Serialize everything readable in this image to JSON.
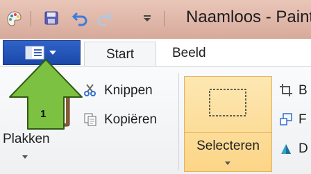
{
  "window": {
    "title": "Naamloos - Paint"
  },
  "quick_access": {
    "icons": [
      "paint-app-icon",
      "save-icon",
      "undo-icon",
      "redo-icon",
      "customize-qat-icon"
    ]
  },
  "tabs": {
    "file_menu_icon": "file-menu-icon",
    "start": "Start",
    "beeld": "Beeld"
  },
  "clipboard": {
    "paste_label": "Plakken",
    "cut_label": "Knippen",
    "copy_label": "Kopiëren"
  },
  "image": {
    "select_label": "Selecteren",
    "crop_initial": "B",
    "resize_initial": "F",
    "rotate_initial": "D"
  },
  "annotation": {
    "step_number": "1",
    "arrow_color": "#7dc142",
    "arrow_outline": "#2e5b12"
  },
  "colors": {
    "file_button": "#1a48a8",
    "selection_highlight": "#fcd587"
  }
}
